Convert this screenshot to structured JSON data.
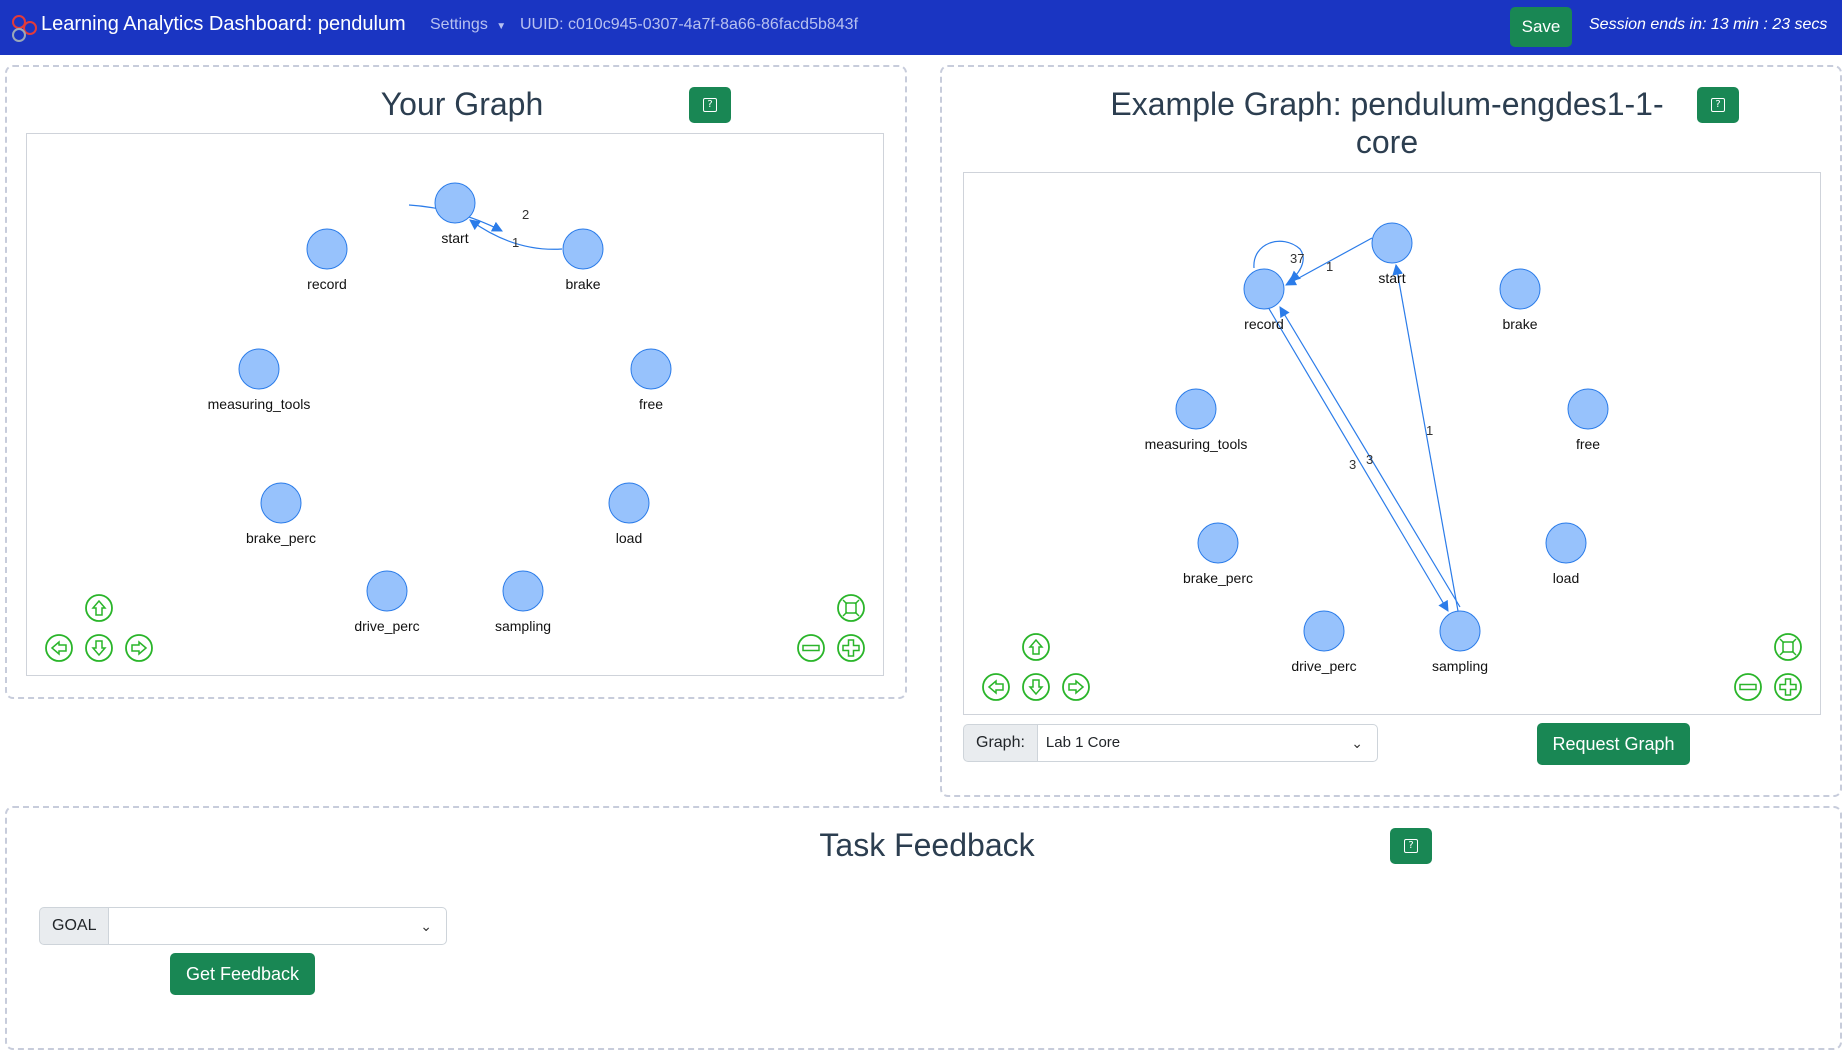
{
  "navbar": {
    "title": "Learning Analytics Dashboard: pendulum",
    "settings_label": "Settings",
    "uuid": "UUID: c010c945-0307-4a7f-8a66-86facd5b843f",
    "save_label": "Save",
    "session": "Session ends in: 13 min : 23 secs"
  },
  "your_graph": {
    "title": "Your Graph",
    "nodes": [
      "start",
      "brake",
      "record",
      "measuring_tools",
      "free",
      "brake_perc",
      "load",
      "drive_perc",
      "sampling"
    ],
    "edges": [
      {
        "from": "start",
        "to": "brake",
        "label": "2"
      },
      {
        "from": "brake",
        "to": "start",
        "label": "1"
      }
    ]
  },
  "example_graph": {
    "title": "Example Graph: pendulum-engdes1-1-core",
    "nodes": [
      "start",
      "record",
      "brake",
      "measuring_tools",
      "free",
      "brake_perc",
      "load",
      "drive_perc",
      "sampling"
    ],
    "edges": [
      {
        "from": "record",
        "to": "record",
        "label": "37"
      },
      {
        "from": "start",
        "to": "record",
        "label": "1"
      },
      {
        "from": "record",
        "to": "sampling",
        "label": "3"
      },
      {
        "from": "sampling",
        "to": "record",
        "label": "3"
      },
      {
        "from": "sampling",
        "to": "start",
        "label": "1"
      }
    ],
    "graph_select_label": "Graph:",
    "graph_select_value": "Lab 1 Core",
    "request_label": "Request Graph"
  },
  "task_feedback": {
    "title": "Task Feedback",
    "goal_label": "GOAL",
    "goal_value": "",
    "get_feedback_label": "Get Feedback"
  },
  "colors": {
    "navbar": "#1a35c2",
    "green": "#198754",
    "node_fill": "#97c2fc",
    "node_stroke": "#2b7ce9",
    "nav_control": "#2ab52a"
  },
  "icons": {
    "nav_up": "arrow-up-icon",
    "nav_down": "arrow-down-icon",
    "nav_left": "arrow-left-icon",
    "nav_right": "arrow-right-icon",
    "zoom_in": "zoom-in-icon",
    "zoom_out": "zoom-out-icon",
    "fit": "fit-icon"
  }
}
